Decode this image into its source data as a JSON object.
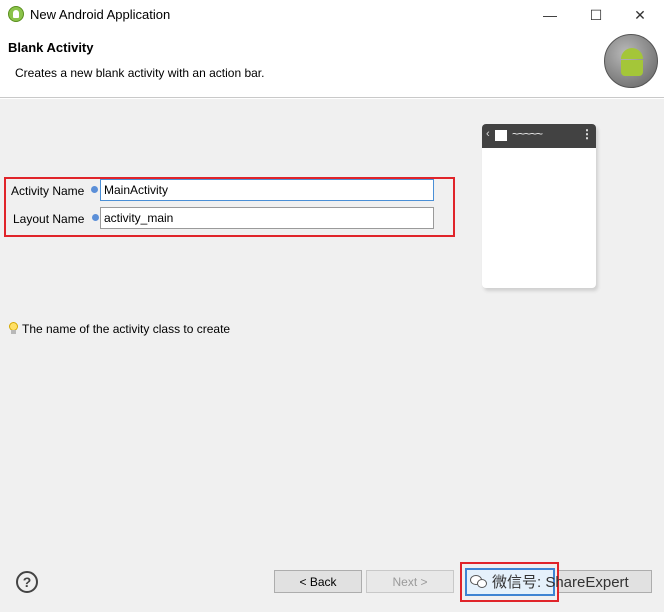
{
  "window": {
    "title": "New Android Application",
    "minimize_glyph": "—",
    "maximize_glyph": "☐",
    "close_glyph": "✕"
  },
  "header": {
    "title": "Blank Activity",
    "description": "Creates a new blank activity with an action bar."
  },
  "form": {
    "activity_name_label": "Activity Name",
    "activity_name_value": "MainActivity",
    "layout_name_label": "Layout Name",
    "layout_name_value": "activity_main"
  },
  "preview": {
    "back_glyph": "‹",
    "wave_glyph": "~~~~~",
    "menu_glyph": "⋮"
  },
  "hint": {
    "text": "The name of the activity class to create"
  },
  "footer": {
    "help_glyph": "?",
    "back_label": "< Back",
    "next_label": "Next >",
    "watermark_text": "微信号: ShareExpert"
  },
  "colors": {
    "highlight_red": "#e0242a",
    "focus_blue": "#3e84d3",
    "android_green": "#a4c639"
  },
  "icons": {
    "app": "android-app-icon",
    "header_logo": "android-logo-icon",
    "hint": "lightbulb-icon",
    "help": "help-icon",
    "info": "info-icon"
  }
}
